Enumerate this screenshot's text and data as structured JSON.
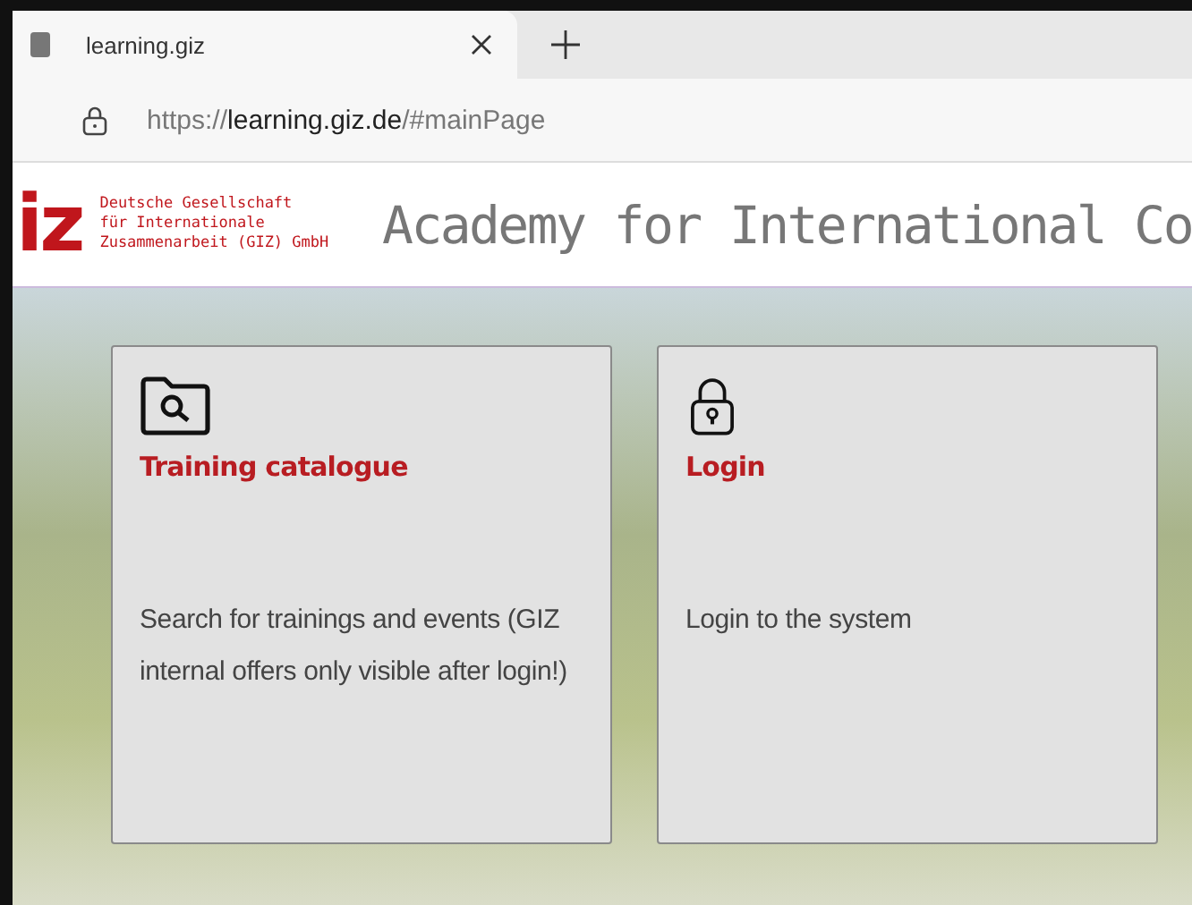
{
  "browser_tab": {
    "title": "learning.giz",
    "selected": true
  },
  "address_bar": {
    "url_scheme": "https://",
    "url_host": "learning.giz.de",
    "url_path": "/#mainPage"
  },
  "header": {
    "logo": "iz",
    "organisation_lines": [
      "Deutsche Gesellschaft",
      "für Internationale",
      "Zusammenarbeit (GIZ) GmbH"
    ],
    "title": "Academy for International Co"
  },
  "cards": [
    {
      "kind": "catalogue",
      "title": "Training catalogue",
      "description": "Search for trainings and events (GIZ internal offers only visible after login!)"
    },
    {
      "kind": "login",
      "title": "Login",
      "description": "Login to the system"
    }
  ]
}
